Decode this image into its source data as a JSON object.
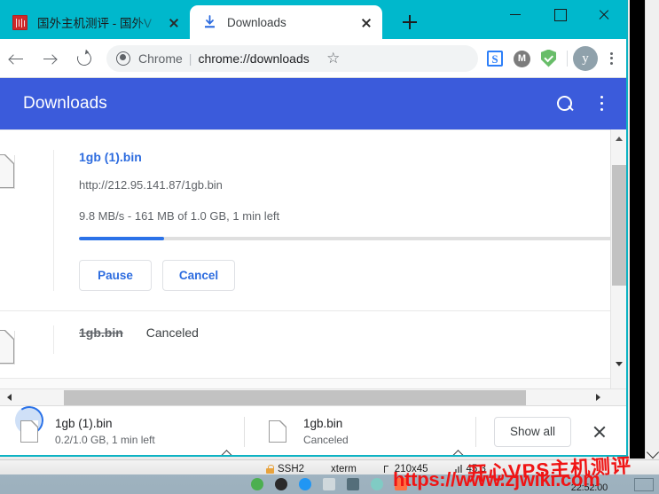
{
  "window": {
    "titlebar_color": "#00b8cc",
    "controls": {
      "minimize": "minimize",
      "maximize": "maximize",
      "close": "close"
    }
  },
  "tabs": [
    {
      "title": "国外主机测评 - 国外V",
      "favicon": "chinese-site-favicon",
      "active": false,
      "close_label": "close-tab"
    },
    {
      "title": "Downloads",
      "favicon": "download-icon",
      "active": true,
      "close_label": "close-tab"
    }
  ],
  "new_tab_label": "new-tab",
  "toolbar": {
    "back": "back",
    "forward": "forward",
    "reload": "reload",
    "omnibox": {
      "scheme_label": "Chrome",
      "divider": "|",
      "url": "chrome://downloads",
      "security_icon": "chrome-page-icon"
    },
    "bookmark_star": "☆",
    "extensions": [
      {
        "name": "similarweb-extension",
        "glyph": "S",
        "color": "#2d7ff9"
      },
      {
        "name": "mega-extension",
        "glyph": "M",
        "color": "#7c7c7c"
      },
      {
        "name": "adguard-extension",
        "glyph": "shield-check",
        "color": "#68bd69"
      }
    ],
    "avatar": {
      "name": "profile-avatar",
      "glyph": "y",
      "color": "#8fa1ab"
    },
    "menu": "chrome-menu"
  },
  "downloads_page": {
    "header": {
      "title": "Downloads",
      "accent": "#3b5bdb",
      "search": "search-downloads",
      "menu": "downloads-menu"
    },
    "items": [
      {
        "filename": "1gb (1).bin",
        "url": "http://212.95.141.87/1gb.bin",
        "status": "9.8 MB/s - 161 MB of 1.0 GB, 1 min left",
        "progress_percent": 16,
        "buttons": [
          {
            "label": "Pause",
            "name": "pause-button"
          },
          {
            "label": "Cancel",
            "name": "cancel-button"
          }
        ]
      },
      {
        "filename": "1gb.bin",
        "status": "Canceled",
        "struck": true
      }
    ]
  },
  "shelf": {
    "items": [
      {
        "filename": "1gb (1).bin",
        "sub": "0.2/1.0 GB, 1 min left",
        "icon": "downloading-file-icon",
        "caret": "shelf-item-menu"
      },
      {
        "filename": "1gb.bin",
        "sub": "Canceled",
        "icon": "file-icon",
        "caret": "shelf-item-menu"
      }
    ],
    "show_all_label": "Show all",
    "close_label": "close-shelf"
  },
  "terminal_status": {
    "protocol": "SSH2",
    "term": "xterm",
    "size": "210x45",
    "cursor": "45,3"
  },
  "taskbar": {
    "clock": "22:52:00"
  },
  "watermark": {
    "url": "https://www.zjwiki.com",
    "text_cn": "开心VPS主机测评"
  }
}
